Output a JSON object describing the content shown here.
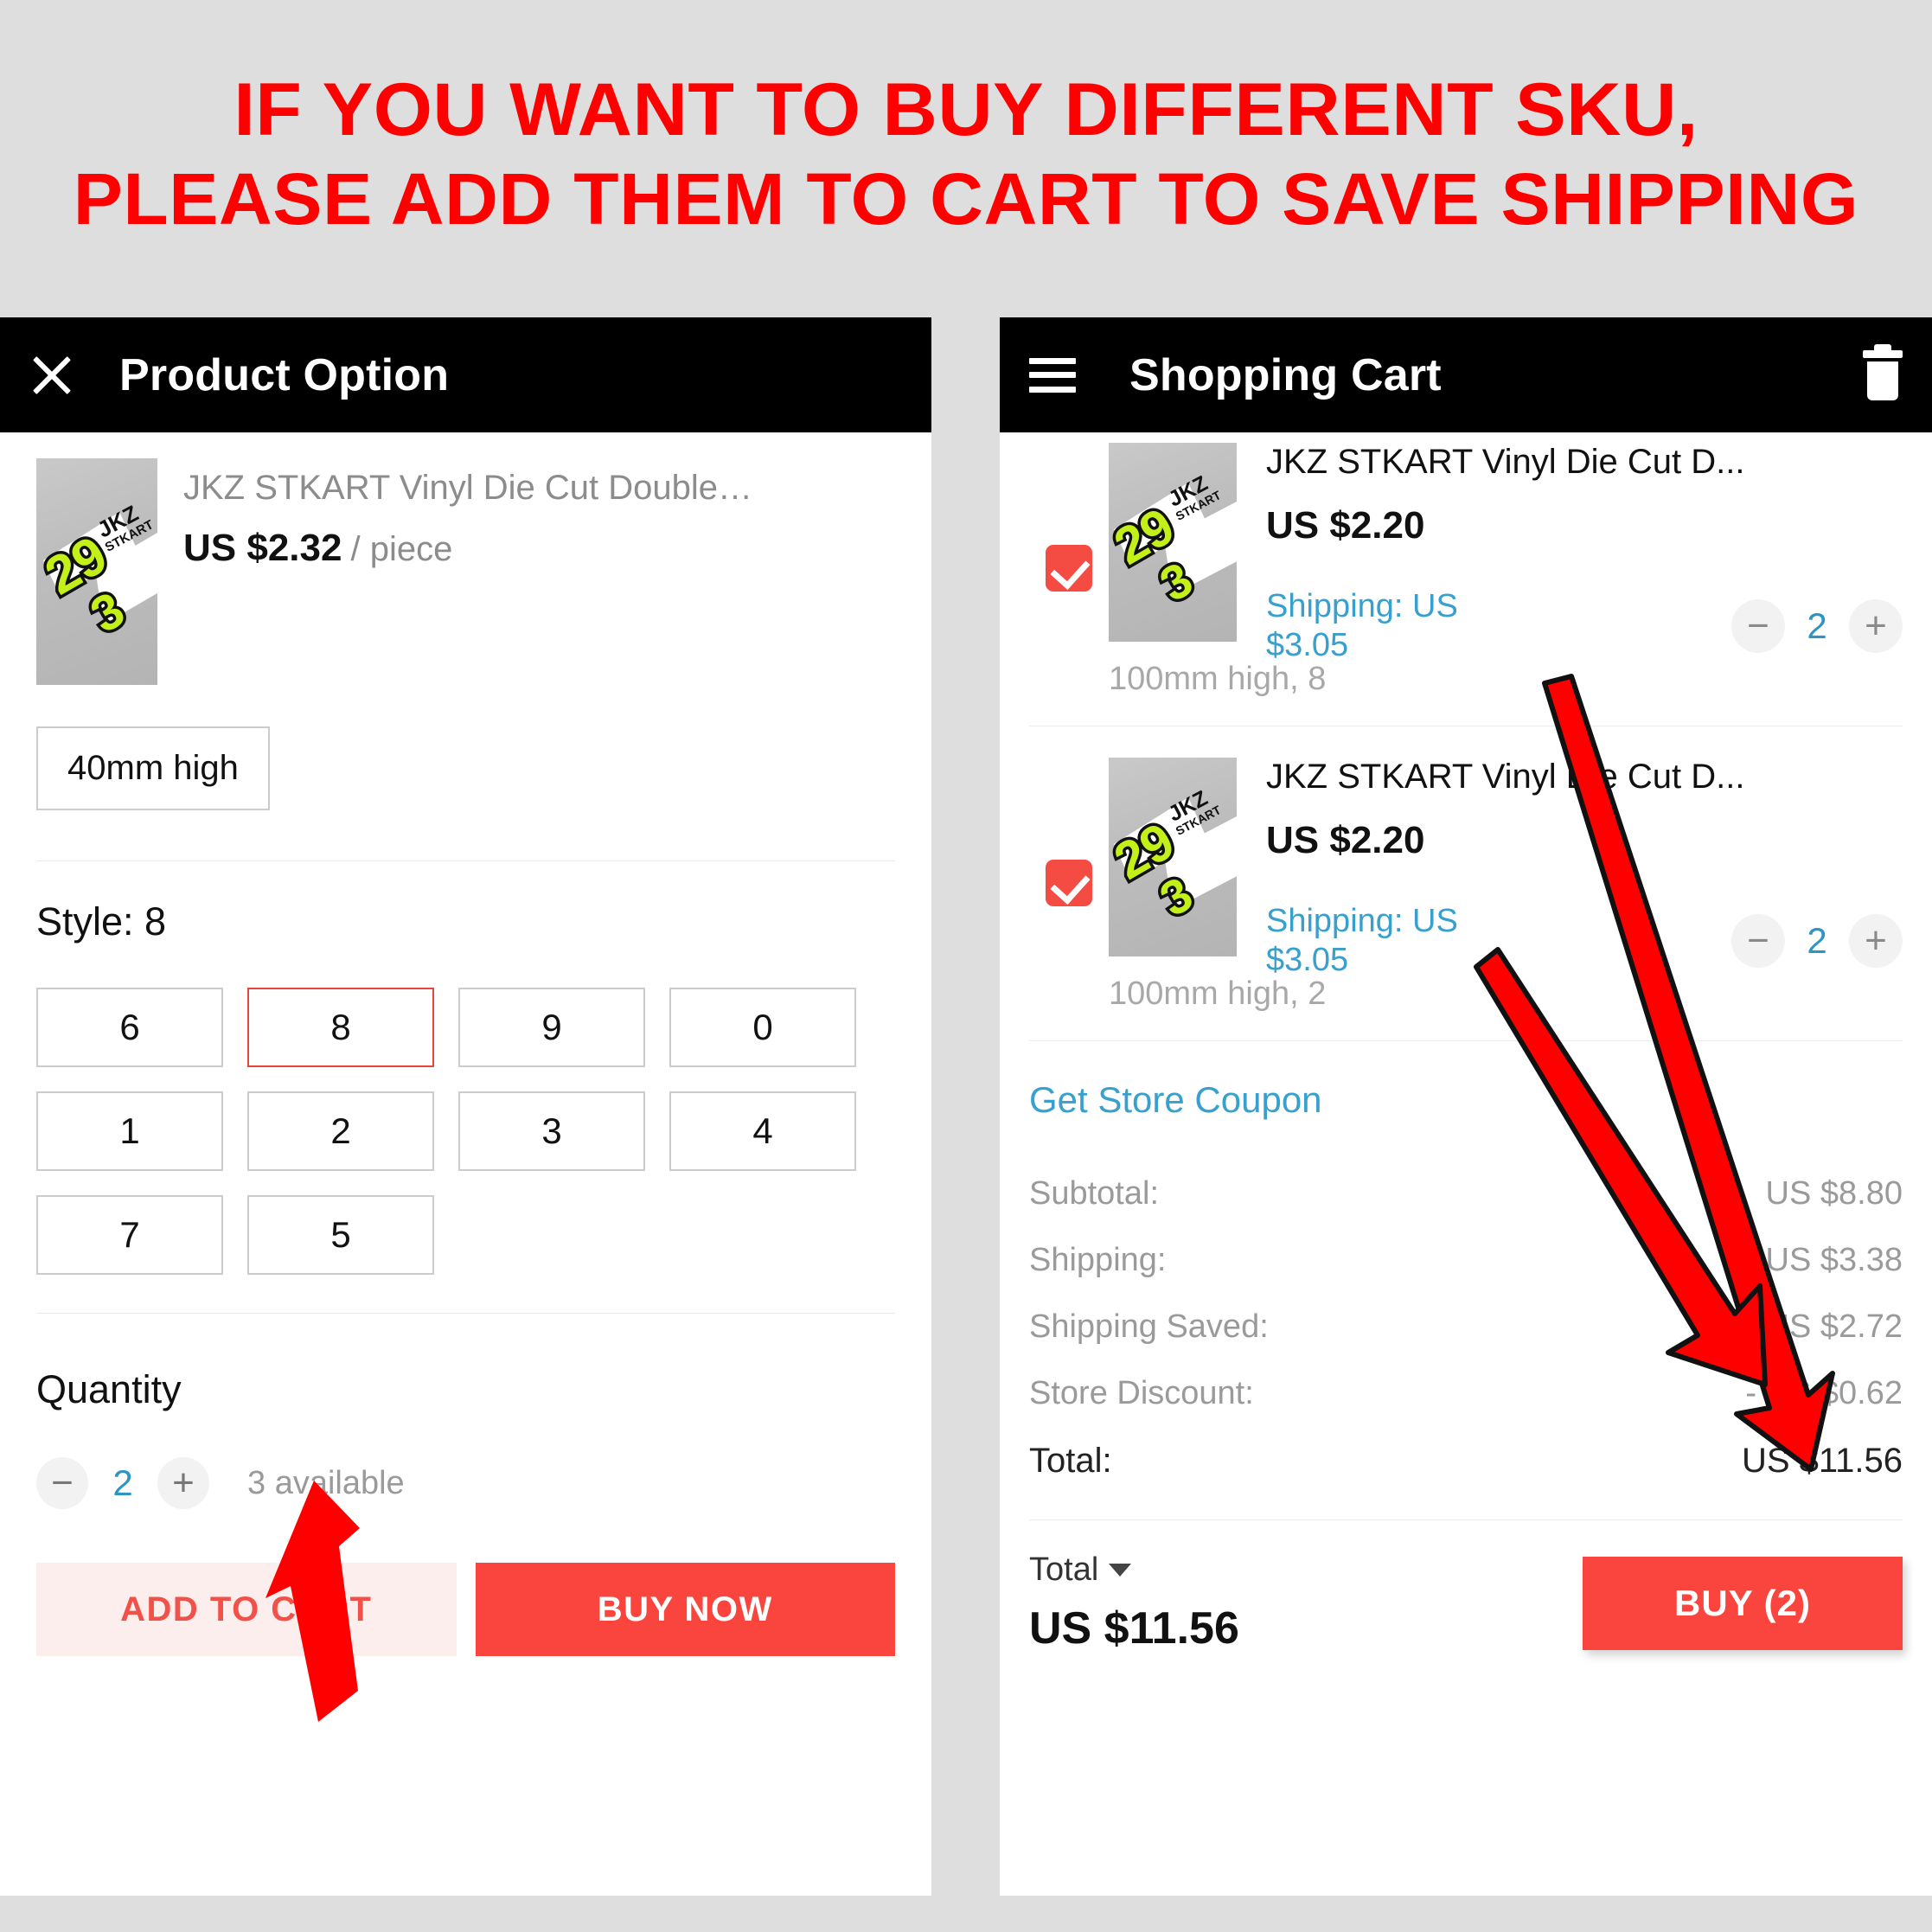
{
  "banner": {
    "line1": "IF YOU WANT TO BUY DIFFERENT SKU,",
    "line2": "PLEASE ADD THEM TO CART TO SAVE SHIPPING",
    "color": "#ff0000"
  },
  "left_panel": {
    "appbar": {
      "close_icon": "close-icon",
      "title": "Product Option"
    },
    "product": {
      "title": "JKZ STKART Vinyl Die Cut Double-l...",
      "price": "US $2.32",
      "unit": "/ piece"
    },
    "size": {
      "selected": "40mm high"
    },
    "style": {
      "label": "Style: 8",
      "options": [
        "6",
        "8",
        "9",
        "0",
        "1",
        "2",
        "3",
        "4",
        "7",
        "5"
      ],
      "selected": "8",
      "selected_border_color": "#e8453c"
    },
    "quantity": {
      "label": "Quantity",
      "minus": "−",
      "value": "2",
      "plus": "+",
      "available": "3  available"
    },
    "actions": {
      "add_to_cart": "ADD TO CART",
      "buy_now": "BUY NOW",
      "add_to_cart_color": "#f2514a",
      "buy_now_color": "#f9453e"
    }
  },
  "right_panel": {
    "appbar": {
      "menu_icon": "hamburger-icon",
      "title": "Shopping Cart",
      "delete_icon": "trash-icon"
    },
    "items": [
      {
        "checked": true,
        "title": "JKZ STKART Vinyl Die Cut D...",
        "price": "US $2.20",
        "shipping": "Shipping: US $3.05",
        "variant": "100mm high, 8",
        "minus": "−",
        "qty": "2",
        "plus": "+"
      },
      {
        "checked": true,
        "title": "JKZ STKART Vinyl Die Cut D...",
        "price": "US $2.20",
        "shipping": "Shipping: US $3.05",
        "variant": "100mm high, 2",
        "minus": "−",
        "qty": "2",
        "plus": "+"
      }
    ],
    "coupon": "Get Store Coupon",
    "summary": [
      {
        "label": "Subtotal:",
        "value": "US $8.80"
      },
      {
        "label": "Shipping:",
        "value": "US $3.38"
      },
      {
        "label": "Shipping Saved:",
        "value": "- US $2.72"
      },
      {
        "label": "Store Discount:",
        "value": "- US $0.62"
      },
      {
        "label": "Total:",
        "value": "US $11.56"
      }
    ],
    "footer": {
      "total_label": "Total",
      "total_value": "US $11.56",
      "buy_label": "BUY (2)",
      "buy_color": "#f9453e"
    }
  },
  "annotations": {
    "arrow_color": "#ff0000",
    "arrows": [
      "arrow-to-add-to-cart",
      "arrow-to-subtotal-a",
      "arrow-to-subtotal-b"
    ]
  }
}
